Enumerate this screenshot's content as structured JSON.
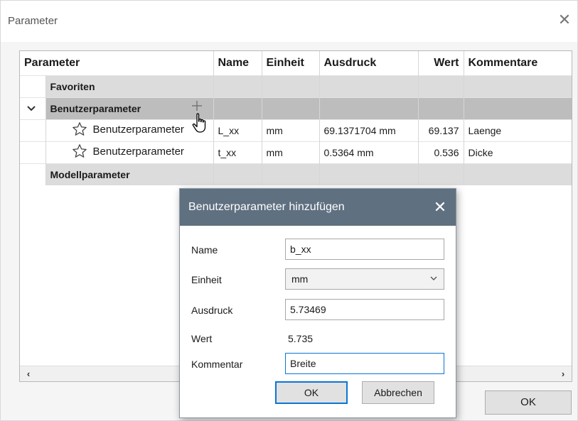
{
  "window": {
    "title": "Parameter",
    "close_glyph": "✕"
  },
  "table": {
    "columns": {
      "parameter": "Parameter",
      "name": "Name",
      "einheit": "Einheit",
      "ausdruck": "Ausdruck",
      "wert": "Wert",
      "kommentare": "Kommentare"
    },
    "groups": {
      "favoriten": "Favoriten",
      "benutzer": "Benutzerparameter",
      "modell": "Modellparameter"
    },
    "expander_glyph": "❯",
    "rows": [
      {
        "label": "Benutzerparameter",
        "name": "L_xx",
        "einheit": "mm",
        "ausdruck": "69.1371704 mm",
        "wert": "69.137",
        "kommentar": "Laenge"
      },
      {
        "label": "Benutzerparameter",
        "name": "t_xx",
        "einheit": "mm",
        "ausdruck": "0.5364 mm",
        "wert": "0.536",
        "kommentar": "Dicke"
      }
    ],
    "icons": {
      "add": "plus-icon",
      "favorite": "star-icon",
      "pointer": "hand-cursor-icon"
    }
  },
  "scrollbar": {
    "left_arrow": "‹",
    "right_arrow": "›"
  },
  "main_ok_label": "OK",
  "dialog": {
    "title": "Benutzerparameter hinzufügen",
    "close_glyph": "✕",
    "fields": {
      "name_label": "Name",
      "name_value": "b_xx",
      "einheit_label": "Einheit",
      "einheit_value": "mm",
      "ausdruck_label": "Ausdruck",
      "ausdruck_value": "5.73469",
      "wert_label": "Wert",
      "wert_value": "5.735",
      "kommentar_label": "Kommentar",
      "kommentar_value": "Breite"
    },
    "ok_label": "OK",
    "cancel_label": "Abbrechen"
  },
  "colors": {
    "dialog_titlebar": "#5f7080",
    "group_row": "#dcdcdc",
    "selected_group_row": "#bdbdbd",
    "focus_border": "#0a76d4"
  }
}
